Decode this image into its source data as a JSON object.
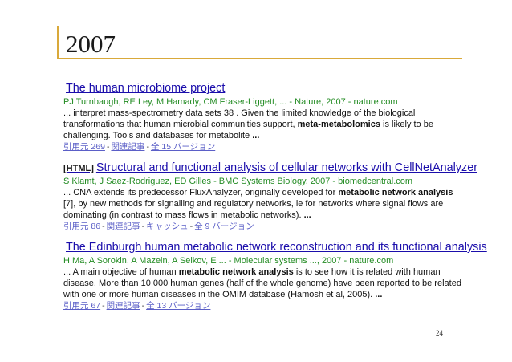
{
  "slide": {
    "title": "2007",
    "page_number": "24",
    "accent_color": "#d9a93a"
  },
  "results": [
    {
      "tag": "",
      "title": "The human microbiome project",
      "meta": "PJ Turnbaugh, RE Ley, M Hamady, CM Fraser-Liggett, ... - Nature, 2007 - nature.com",
      "snippet_parts": [
        {
          "text": "... interpret mass-spectrometry data sets 38 . Given the limited knowledge of the biological transformations that human microbial communities support, ",
          "bold": false
        },
        {
          "text": "meta-metabolomics",
          "bold": true
        },
        {
          "text": " is likely to be challenging. Tools and databases for metabolite ",
          "bold": false
        },
        {
          "text": "...",
          "bold": true
        }
      ],
      "links": [
        "引用元 269",
        "関連記事",
        "全 15 バージョン"
      ]
    },
    {
      "tag": "[HTML]",
      "title": "Structural and functional analysis of cellular networks with CellNetAnalyzer",
      "meta": "S Klamt, J Saez-Rodriguez, ED Gilles - BMC Systems Biology, 2007 - biomedcentral.com",
      "snippet_parts": [
        {
          "text": "... CNA extends its predecessor FluxAnalyzer, originally developed for ",
          "bold": false
        },
        {
          "text": "metabolic network analysis",
          "bold": true
        },
        {
          "text": " [7], by new methods for signalling and regulatory networks, ie for networks where signal flows are dominating (in contrast to mass flows in metabolic networks). ",
          "bold": false
        },
        {
          "text": "...",
          "bold": true
        }
      ],
      "links": [
        "引用元 86",
        "関連記事",
        "キャッシュ",
        "全 9 バージョン"
      ]
    },
    {
      "tag": "",
      "title": "The Edinburgh human metabolic network reconstruction and its functional analysis",
      "meta": "H Ma, A Sorokin, A Mazein, A Selkov, E ... - Molecular systems ..., 2007 - nature.com",
      "snippet_parts": [
        {
          "text": "... A main objective of human ",
          "bold": false
        },
        {
          "text": "metabolic network analysis",
          "bold": true
        },
        {
          "text": " is to see how it is related with human disease. More than 10 000 human genes (half of the whole genome) have been reported to be related with one or more human diseases in the OMIM database (Hamosh et al, 2005). ",
          "bold": false
        },
        {
          "text": "...",
          "bold": true
        }
      ],
      "links": [
        "引用元 67",
        "関連記事",
        "全 13 バージョン"
      ]
    }
  ]
}
